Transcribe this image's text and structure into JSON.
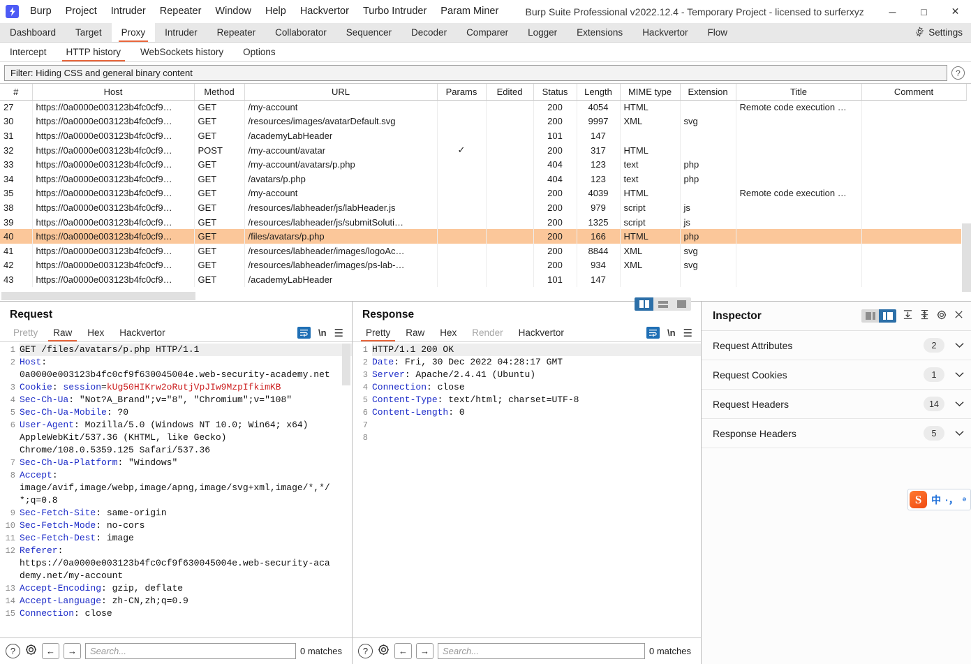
{
  "window": {
    "title": "Burp Suite Professional v2022.12.4 - Temporary Project - licensed to surferxyz",
    "logo_icon": "burp-logo-icon",
    "minimize_label": "─",
    "maximize_label": "□",
    "close_label": "✕"
  },
  "menubar": {
    "items": [
      "Burp",
      "Project",
      "Intruder",
      "Repeater",
      "Window",
      "Help",
      "Hackvertor",
      "Turbo Intruder",
      "Param Miner"
    ]
  },
  "main_tabs": {
    "items": [
      "Dashboard",
      "Target",
      "Proxy",
      "Intruder",
      "Repeater",
      "Collaborator",
      "Sequencer",
      "Decoder",
      "Comparer",
      "Logger",
      "Extensions",
      "Hackvertor",
      "Flow"
    ],
    "active": "Proxy",
    "settings_label": "Settings"
  },
  "sub_tabs": {
    "items": [
      "Intercept",
      "HTTP history",
      "WebSockets history",
      "Options"
    ],
    "active": "HTTP history"
  },
  "filter": {
    "text": "Filter: Hiding CSS and general binary content",
    "help_icon": "question-mark-icon"
  },
  "http_table": {
    "columns": [
      "#",
      "Host",
      "Method",
      "URL",
      "Params",
      "Edited",
      "Status",
      "Length",
      "MIME type",
      "Extension",
      "Title",
      "Comment"
    ],
    "rows": [
      {
        "num": "27",
        "host": "https://0a0000e003123b4fc0cf9…",
        "method": "GET",
        "url": "/my-account",
        "params": "",
        "edited": "",
        "status": "200",
        "length": "4054",
        "mime": "HTML",
        "ext": "",
        "title": "Remote code execution …",
        "comment": "",
        "selected": false
      },
      {
        "num": "30",
        "host": "https://0a0000e003123b4fc0cf9…",
        "method": "GET",
        "url": "/resources/images/avatarDefault.svg",
        "params": "",
        "edited": "",
        "status": "200",
        "length": "9997",
        "mime": "XML",
        "ext": "svg",
        "title": "",
        "comment": "",
        "selected": false
      },
      {
        "num": "31",
        "host": "https://0a0000e003123b4fc0cf9…",
        "method": "GET",
        "url": "/academyLabHeader",
        "params": "",
        "edited": "",
        "status": "101",
        "length": "147",
        "mime": "",
        "ext": "",
        "title": "",
        "comment": "",
        "selected": false
      },
      {
        "num": "32",
        "host": "https://0a0000e003123b4fc0cf9…",
        "method": "POST",
        "url": "/my-account/avatar",
        "params": "✓",
        "edited": "",
        "status": "200",
        "length": "317",
        "mime": "HTML",
        "ext": "",
        "title": "",
        "comment": "",
        "selected": false
      },
      {
        "num": "33",
        "host": "https://0a0000e003123b4fc0cf9…",
        "method": "GET",
        "url": "/my-account/avatars/p.php",
        "params": "",
        "edited": "",
        "status": "404",
        "length": "123",
        "mime": "text",
        "ext": "php",
        "title": "",
        "comment": "",
        "selected": false
      },
      {
        "num": "34",
        "host": "https://0a0000e003123b4fc0cf9…",
        "method": "GET",
        "url": "/avatars/p.php",
        "params": "",
        "edited": "",
        "status": "404",
        "length": "123",
        "mime": "text",
        "ext": "php",
        "title": "",
        "comment": "",
        "selected": false
      },
      {
        "num": "35",
        "host": "https://0a0000e003123b4fc0cf9…",
        "method": "GET",
        "url": "/my-account",
        "params": "",
        "edited": "",
        "status": "200",
        "length": "4039",
        "mime": "HTML",
        "ext": "",
        "title": "Remote code execution …",
        "comment": "",
        "selected": false
      },
      {
        "num": "38",
        "host": "https://0a0000e003123b4fc0cf9…",
        "method": "GET",
        "url": "/resources/labheader/js/labHeader.js",
        "params": "",
        "edited": "",
        "status": "200",
        "length": "979",
        "mime": "script",
        "ext": "js",
        "title": "",
        "comment": "",
        "selected": false
      },
      {
        "num": "39",
        "host": "https://0a0000e003123b4fc0cf9…",
        "method": "GET",
        "url": "/resources/labheader/js/submitSoluti…",
        "params": "",
        "edited": "",
        "status": "200",
        "length": "1325",
        "mime": "script",
        "ext": "js",
        "title": "",
        "comment": "",
        "selected": false
      },
      {
        "num": "40",
        "host": "https://0a0000e003123b4fc0cf9…",
        "method": "GET",
        "url": "/files/avatars/p.php",
        "params": "",
        "edited": "",
        "status": "200",
        "length": "166",
        "mime": "HTML",
        "ext": "php",
        "title": "",
        "comment": "",
        "selected": true
      },
      {
        "num": "41",
        "host": "https://0a0000e003123b4fc0cf9…",
        "method": "GET",
        "url": "/resources/labheader/images/logoAc…",
        "params": "",
        "edited": "",
        "status": "200",
        "length": "8844",
        "mime": "XML",
        "ext": "svg",
        "title": "",
        "comment": "",
        "selected": false
      },
      {
        "num": "42",
        "host": "https://0a0000e003123b4fc0cf9…",
        "method": "GET",
        "url": "/resources/labheader/images/ps-lab-…",
        "params": "",
        "edited": "",
        "status": "200",
        "length": "934",
        "mime": "XML",
        "ext": "svg",
        "title": "",
        "comment": "",
        "selected": false
      },
      {
        "num": "43",
        "host": "https://0a0000e003123b4fc0cf9…",
        "method": "GET",
        "url": "/academyLabHeader",
        "params": "",
        "edited": "",
        "status": "101",
        "length": "147",
        "mime": "",
        "ext": "",
        "title": "",
        "comment": "",
        "selected": false
      }
    ]
  },
  "request": {
    "title": "Request",
    "tabs": [
      "Pretty",
      "Raw",
      "Hex",
      "Hackvertor"
    ],
    "active_tab": "Raw",
    "disabled_tabs": [
      "Pretty"
    ],
    "icons": [
      "word-wrap-icon",
      "newline-icon",
      "menu-icon"
    ],
    "lines": [
      {
        "n": "1",
        "parts": [
          {
            "t": "GET /files/avatars/p.php HTTP/1.1",
            "c": "blk"
          }
        ],
        "first": true
      },
      {
        "n": "2",
        "parts": [
          {
            "t": "Host",
            "c": "hdr"
          },
          {
            "t": ": \n0a0000e003123b4fc0cf9f630045004e.web-security-academy.net",
            "c": "blk"
          }
        ]
      },
      {
        "n": "3",
        "parts": [
          {
            "t": "Cookie",
            "c": "hdr"
          },
          {
            "t": ": ",
            "c": "blk"
          },
          {
            "t": "session",
            "c": "hdr"
          },
          {
            "t": "=",
            "c": "blk"
          },
          {
            "t": "kUg50HIKrw2oRutjVpJIw9MzpIfkimKB",
            "c": "red"
          }
        ]
      },
      {
        "n": "4",
        "parts": [
          {
            "t": "Sec-Ch-Ua",
            "c": "hdr"
          },
          {
            "t": ": \"Not?A_Brand\";v=\"8\", \"Chromium\";v=\"108\"",
            "c": "blk"
          }
        ]
      },
      {
        "n": "5",
        "parts": [
          {
            "t": "Sec-Ch-Ua-Mobile",
            "c": "hdr"
          },
          {
            "t": ": ?0",
            "c": "blk"
          }
        ]
      },
      {
        "n": "6",
        "parts": [
          {
            "t": "User-Agent",
            "c": "hdr"
          },
          {
            "t": ": Mozilla/5.0 (Windows NT 10.0; Win64; x64) \nAppleWebKit/537.36 (KHTML, like Gecko) \nChrome/108.0.5359.125 Safari/537.36",
            "c": "blk"
          }
        ]
      },
      {
        "n": "7",
        "parts": [
          {
            "t": "Sec-Ch-Ua-Platform",
            "c": "hdr"
          },
          {
            "t": ": \"Windows\"",
            "c": "blk"
          }
        ]
      },
      {
        "n": "8",
        "parts": [
          {
            "t": "Accept",
            "c": "hdr"
          },
          {
            "t": ": \nimage/avif,image/webp,image/apng,image/svg+xml,image/*,*/\n*;q=0.8",
            "c": "blk"
          }
        ]
      },
      {
        "n": "9",
        "parts": [
          {
            "t": "Sec-Fetch-Site",
            "c": "hdr"
          },
          {
            "t": ": same-origin",
            "c": "blk"
          }
        ]
      },
      {
        "n": "10",
        "parts": [
          {
            "t": "Sec-Fetch-Mode",
            "c": "hdr"
          },
          {
            "t": ": no-cors",
            "c": "blk"
          }
        ]
      },
      {
        "n": "11",
        "parts": [
          {
            "t": "Sec-Fetch-Dest",
            "c": "hdr"
          },
          {
            "t": ": image",
            "c": "blk"
          }
        ]
      },
      {
        "n": "12",
        "parts": [
          {
            "t": "Referer",
            "c": "hdr"
          },
          {
            "t": ": \nhttps://0a0000e003123b4fc0cf9f630045004e.web-security-aca\ndemy.net/my-account",
            "c": "blk"
          }
        ]
      },
      {
        "n": "13",
        "parts": [
          {
            "t": "Accept-Encoding",
            "c": "hdr"
          },
          {
            "t": ": gzip, deflate",
            "c": "blk"
          }
        ]
      },
      {
        "n": "14",
        "parts": [
          {
            "t": "Accept-Language",
            "c": "hdr"
          },
          {
            "t": ": zh-CN,zh;q=0.9",
            "c": "blk"
          }
        ]
      },
      {
        "n": "15",
        "parts": [
          {
            "t": "Connection",
            "c": "hdr"
          },
          {
            "t": ": close",
            "c": "blk"
          }
        ]
      }
    ],
    "search_placeholder": "Search...",
    "matches": "0 matches",
    "help_icon": "question-mark-icon",
    "gear_icon": "gear-icon",
    "prev_icon": "arrow-left-icon",
    "next_icon": "arrow-right-icon"
  },
  "response": {
    "title": "Response",
    "tabs": [
      "Pretty",
      "Raw",
      "Hex",
      "Render",
      "Hackvertor"
    ],
    "active_tab": "Pretty",
    "disabled_tabs": [
      "Render"
    ],
    "view_modes": [
      "split-view-icon",
      "stacked-view-icon",
      "single-view-icon"
    ],
    "active_view_mode": "split-view-icon",
    "lines": [
      {
        "n": "1",
        "parts": [
          {
            "t": "HTTP/1.1 200 OK",
            "c": "blk"
          }
        ],
        "first": true
      },
      {
        "n": "2",
        "parts": [
          {
            "t": "Date",
            "c": "hdr"
          },
          {
            "t": ": Fri, 30 Dec 2022 04:28:17 GMT",
            "c": "blk"
          }
        ]
      },
      {
        "n": "3",
        "parts": [
          {
            "t": "Server",
            "c": "hdr"
          },
          {
            "t": ": Apache/2.4.41 (Ubuntu)",
            "c": "blk"
          }
        ]
      },
      {
        "n": "4",
        "parts": [
          {
            "t": "Connection",
            "c": "hdr"
          },
          {
            "t": ": close",
            "c": "blk"
          }
        ]
      },
      {
        "n": "5",
        "parts": [
          {
            "t": "Content-Type",
            "c": "hdr"
          },
          {
            "t": ": text/html; charset=UTF-8",
            "c": "blk"
          }
        ]
      },
      {
        "n": "6",
        "parts": [
          {
            "t": "Content-Length",
            "c": "hdr"
          },
          {
            "t": ": 0",
            "c": "blk"
          }
        ]
      },
      {
        "n": "7",
        "parts": [
          {
            "t": "",
            "c": "blk"
          }
        ]
      },
      {
        "n": "8",
        "parts": [
          {
            "t": "",
            "c": "blk"
          }
        ]
      }
    ],
    "search_placeholder": "Search...",
    "matches": "0 matches",
    "help_icon": "question-mark-icon",
    "gear_icon": "gear-icon",
    "prev_icon": "arrow-left-icon",
    "next_icon": "arrow-right-icon"
  },
  "inspector": {
    "title": "Inspector",
    "toolbar_icons": [
      "side-panel-icon",
      "split-panel-icon",
      "expand-all-icon",
      "collapse-all-icon",
      "gear-icon",
      "close-icon"
    ],
    "sections": [
      {
        "label": "Request Attributes",
        "count": "2"
      },
      {
        "label": "Request Cookies",
        "count": "1"
      },
      {
        "label": "Request Headers",
        "count": "14"
      },
      {
        "label": "Response Headers",
        "count": "5"
      }
    ],
    "chevron_icon": "chevron-down-icon"
  },
  "ime": {
    "logo_text": "S",
    "items": [
      "中",
      "·，",
      "ᵊ"
    ]
  },
  "colors": {
    "accent": "#e8663c",
    "selected_row": "#fbc79a",
    "blue": "#2c6fa8",
    "header_blue": "#1d2cc8",
    "cookie_red": "#cc2020"
  }
}
